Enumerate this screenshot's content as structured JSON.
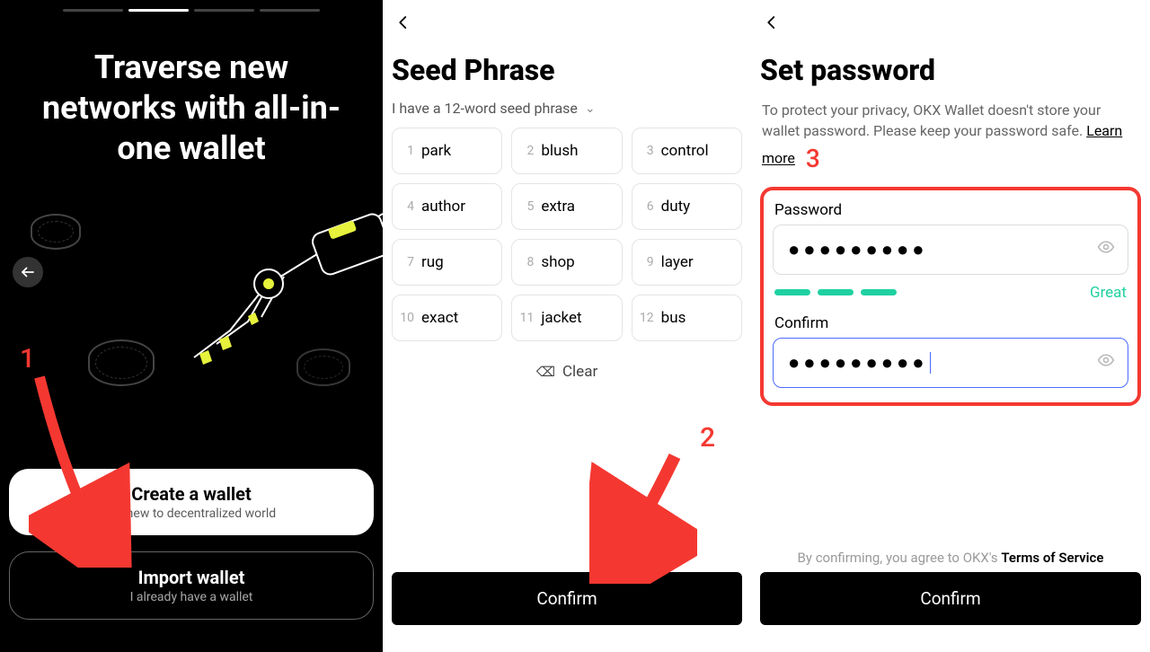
{
  "panel1": {
    "title": "Traverse new networks with all-in-one wallet",
    "create_button": {
      "title": "Create a wallet",
      "subtitle": "I'm new to decentralized world"
    },
    "import_button": {
      "title": "Import wallet",
      "subtitle": "I already have a wallet"
    }
  },
  "panel2": {
    "title": "Seed Phrase",
    "selector_text": "I have a 12-word seed phrase",
    "words": [
      "park",
      "blush",
      "control",
      "author",
      "extra",
      "duty",
      "rug",
      "shop",
      "layer",
      "exact",
      "jacket",
      "bus"
    ],
    "clear_label": "Clear",
    "confirm_label": "Confirm"
  },
  "panel3": {
    "title": "Set password",
    "desc_text": "To protect your privacy, OKX Wallet doesn't store your wallet password. Please keep your password safe.  ",
    "learn_label": "Learn more",
    "password_label": "Password",
    "confirm_label": "Confirm",
    "password_value": "●●●●●●●●●",
    "confirm_value": "●●●●●●●●●",
    "strength_label": "Great",
    "tos_prefix": "By confirming, you agree to OKX's ",
    "tos_link": "Terms of Service",
    "confirm_button": "Confirm"
  },
  "annotations": {
    "n1": "1",
    "n2": "2",
    "n3": "3"
  }
}
